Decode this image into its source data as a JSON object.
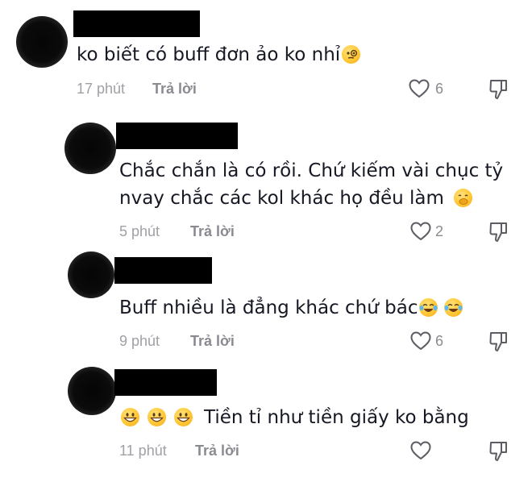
{
  "comments": [
    {
      "text": "ko biết có buff đơn ảo ko nhỉ",
      "emojis": [
        "monocle-face"
      ],
      "time": "17 phút",
      "reply_label": "Trả lời",
      "likes": "6"
    },
    {
      "text_lines": [
        "Chắc chắn là có rồi. Chứ kiếm vài chục tỷ",
        "nvay chắc các kol khác họ đều làm"
      ],
      "emojis": [
        "hand-over-mouth-face"
      ],
      "time": "5 phút",
      "reply_label": "Trả lời",
      "likes": "2"
    },
    {
      "text": "Buff nhiều là đẳng khác chứ bác",
      "emojis": [
        "tears-of-joy",
        "tears-of-joy"
      ],
      "time": "9 phút",
      "reply_label": "Trả lời",
      "likes": "6"
    },
    {
      "text": "Tiền tỉ như tiền giấy ko bằng",
      "emojis_before": [
        "grinning-face",
        "grinning-face",
        "grinning-face"
      ],
      "time": "11 phút",
      "reply_label": "Trả lời",
      "likes": ""
    }
  ],
  "icons": {
    "like": "heart-outline-icon",
    "dislike": "thumbs-down-outline-icon"
  }
}
